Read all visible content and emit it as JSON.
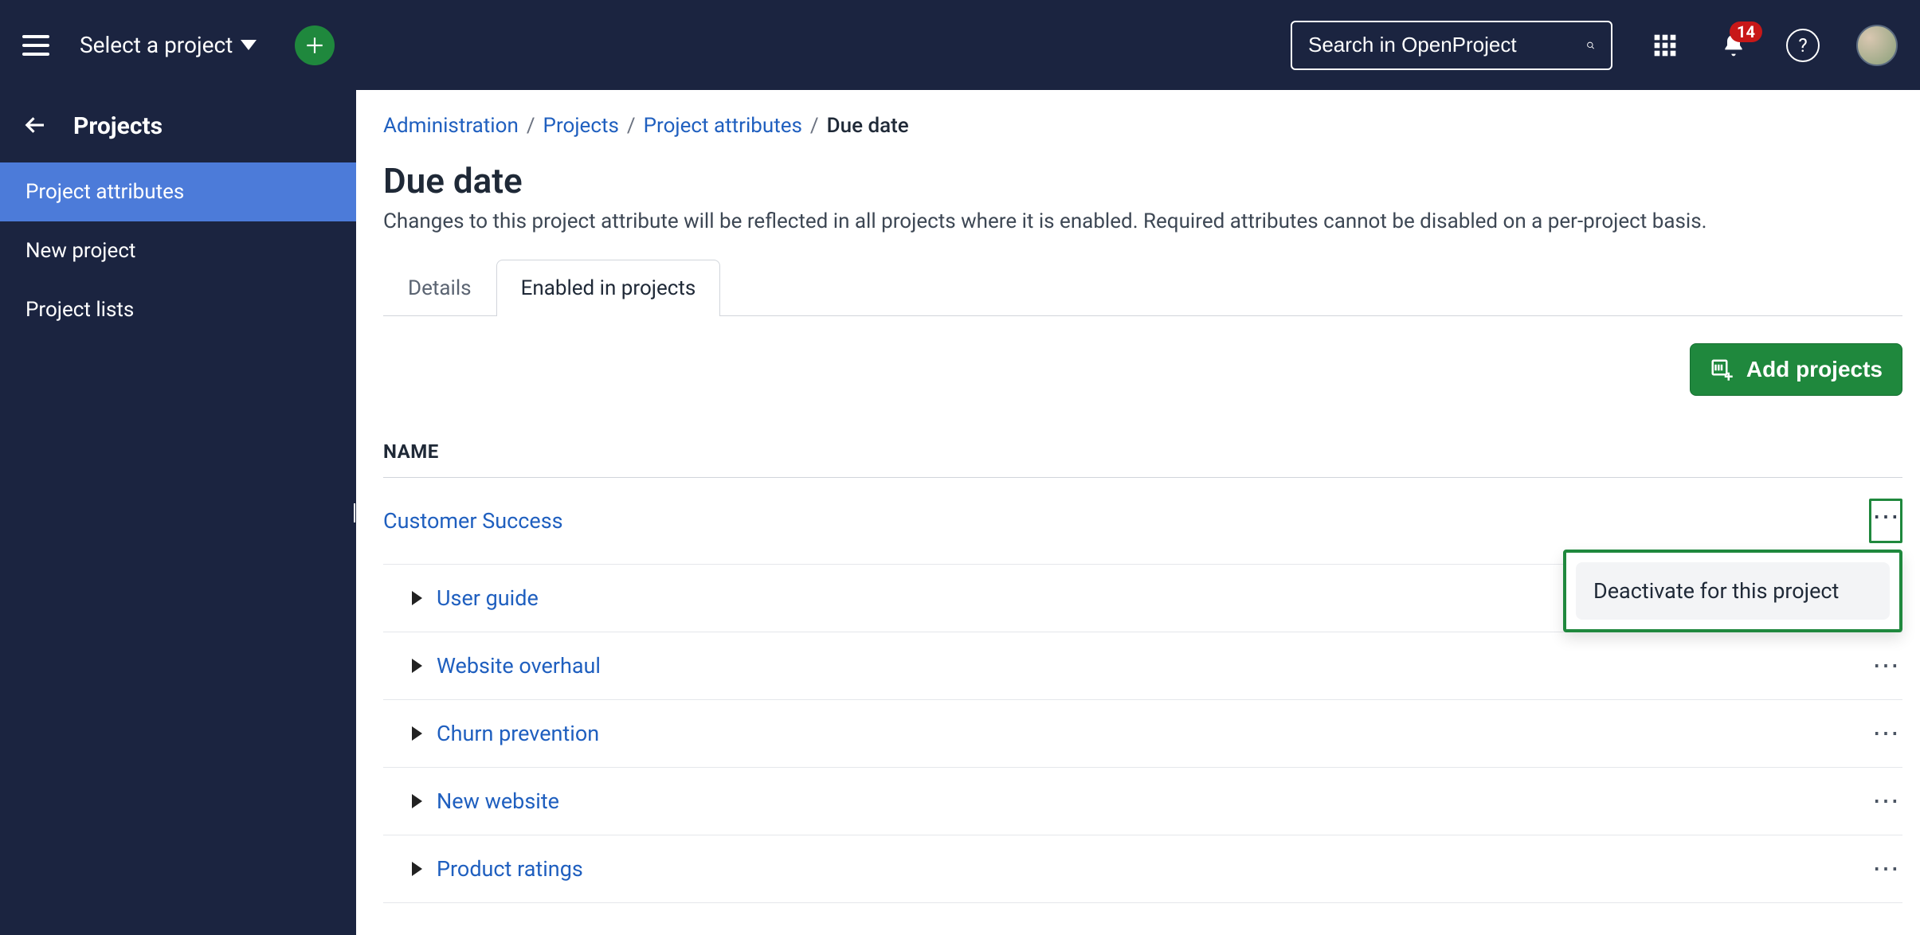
{
  "topbar": {
    "select_project": "Select a project",
    "search_placeholder": "Search in OpenProject",
    "notification_count": "14"
  },
  "sidebar": {
    "title": "Projects",
    "items": [
      {
        "label": "Project attributes",
        "active": true
      },
      {
        "label": "New project",
        "active": false
      },
      {
        "label": "Project lists",
        "active": false
      }
    ]
  },
  "breadcrumb": {
    "items": [
      {
        "label": "Administration"
      },
      {
        "label": "Projects"
      },
      {
        "label": "Project attributes"
      }
    ],
    "current": "Due date"
  },
  "page": {
    "title": "Due date",
    "description": "Changes to this project attribute will be reflected in all projects where it is enabled. Required attributes cannot be disabled on a per-project basis."
  },
  "tabs": {
    "details": "Details",
    "enabled": "Enabled in projects"
  },
  "actions": {
    "add_projects": "Add projects"
  },
  "table": {
    "header": "NAME",
    "rows": [
      {
        "label": "Customer Success",
        "child": false
      },
      {
        "label": "User guide",
        "child": true
      },
      {
        "label": "Website overhaul",
        "child": true
      },
      {
        "label": "Churn prevention",
        "child": true
      },
      {
        "label": "New website",
        "child": true
      },
      {
        "label": "Product ratings",
        "child": true
      }
    ]
  },
  "popover": {
    "deactivate": "Deactivate for this project"
  }
}
